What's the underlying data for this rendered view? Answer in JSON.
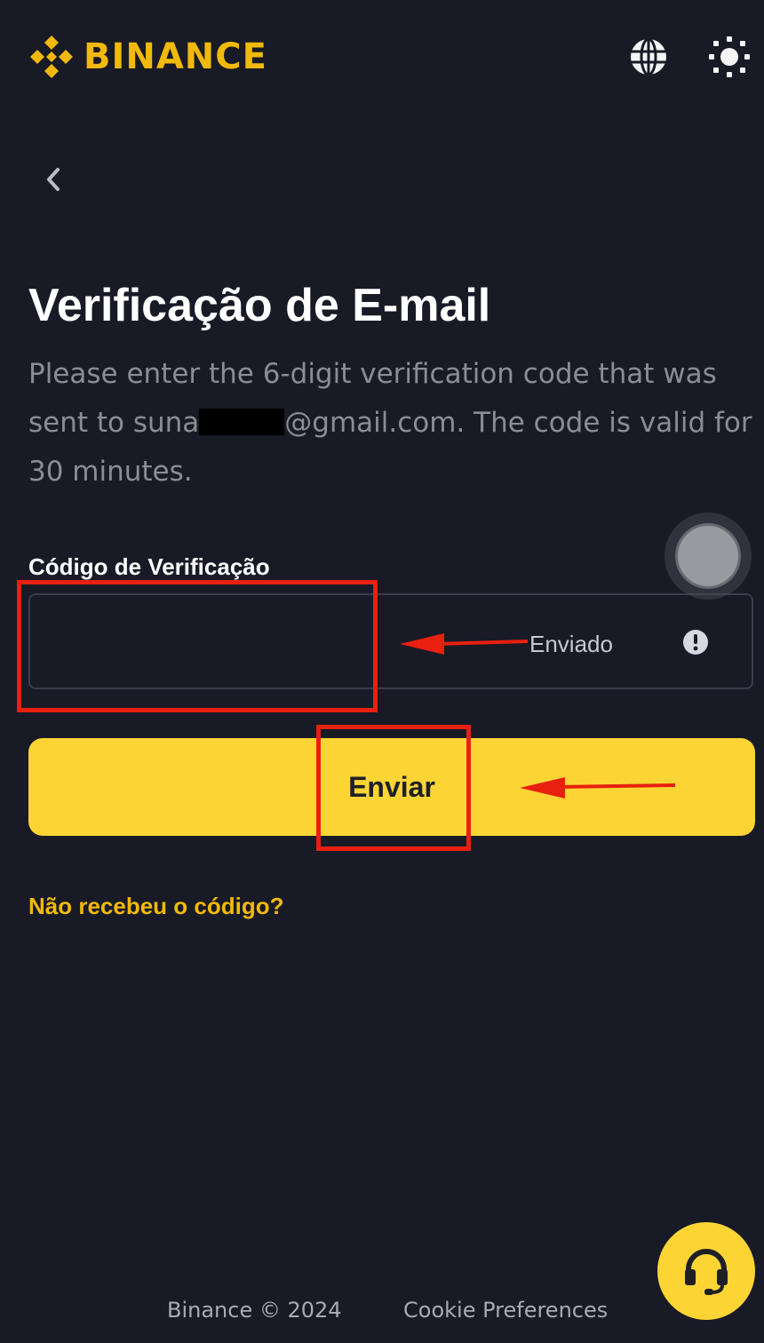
{
  "header": {
    "brand": "BINANCE",
    "icons": [
      "binance-logo-icon",
      "globe-icon",
      "theme-toggle-icon"
    ]
  },
  "navigation": {
    "back_icon": "chevron-left-icon"
  },
  "page": {
    "title": "Verificação de E-mail",
    "description_before": "Please enter the 6-digit verification code that was sent to suna",
    "description_after": "@gmail.com. The code is valid for 30 minutes.",
    "code_label": "Código de Verificação",
    "code_value": "",
    "sent_status": "Enviado",
    "submit_label": "Enviar",
    "resend_link": "Não recebeu o código?"
  },
  "footer": {
    "copyright": "Binance © 2024",
    "cookie_link": "Cookie Preferences"
  },
  "colors": {
    "background": "#181a26",
    "brand_yellow": "#fcd535",
    "link_yellow": "#f0b90b",
    "annotation_red": "#e8200f"
  }
}
